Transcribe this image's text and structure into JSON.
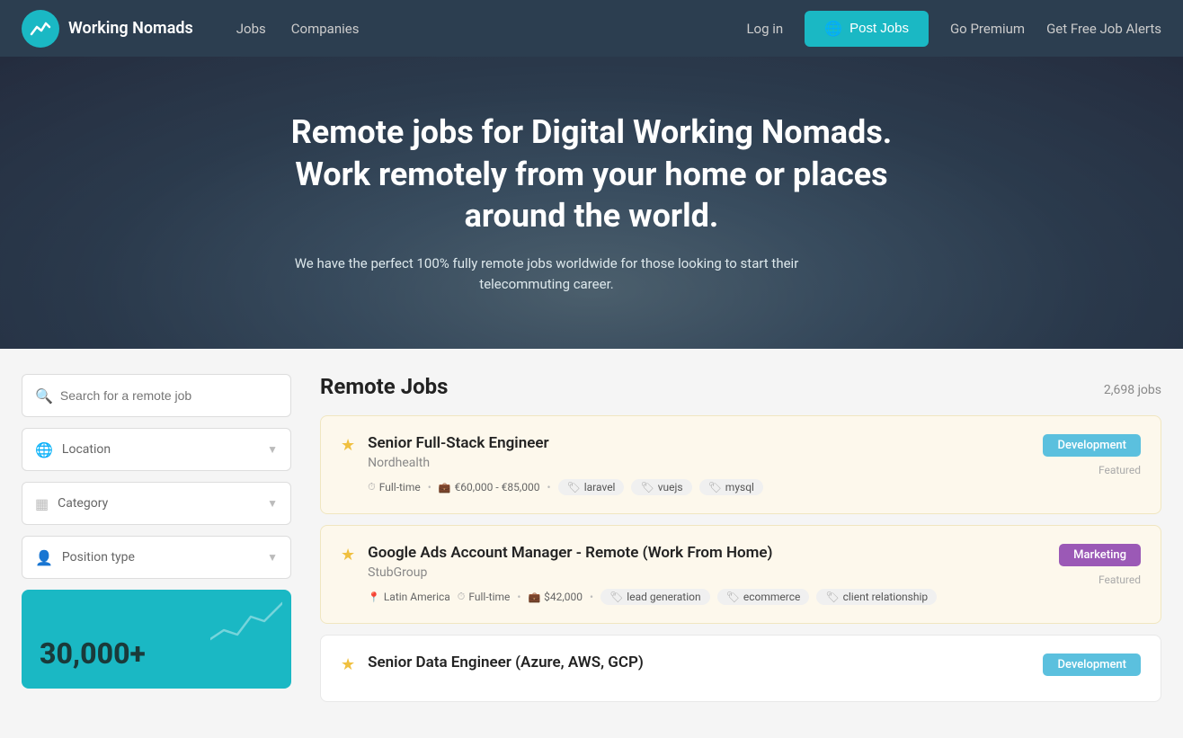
{
  "nav": {
    "brand": "Working Nomads",
    "logo_icon": "~",
    "links": [
      "Jobs",
      "Companies"
    ],
    "right_links": [
      "Log in",
      "Go Premium",
      "Get Free Job Alerts"
    ],
    "post_jobs_label": "Post Jobs"
  },
  "hero": {
    "title": "Remote jobs for Digital Working Nomads. Work remotely from your home or places around the world.",
    "subtitle": "We have the perfect 100% fully remote jobs worldwide for those looking to start their telecommuting career."
  },
  "sidebar": {
    "search_placeholder": "Search for a remote job",
    "filters": [
      {
        "id": "location",
        "label": "Location",
        "icon": "🌐"
      },
      {
        "id": "category",
        "label": "Category",
        "icon": "▦"
      },
      {
        "id": "position_type",
        "label": "Position type",
        "icon": "👤"
      }
    ],
    "promo_number": "30,000+"
  },
  "jobs": {
    "section_title": "Remote Jobs",
    "count_label": "2,698 jobs",
    "items": [
      {
        "id": 1,
        "featured": true,
        "starred": true,
        "title": "Senior Full-Stack Engineer",
        "company": "Nordhealth",
        "badge": "Development",
        "badge_type": "dev",
        "featured_label": "Featured",
        "tags": [
          {
            "type": "time",
            "icon": "⏱",
            "label": "Full-time"
          },
          {
            "type": "salary",
            "icon": "💼",
            "label": "€60,000 - €85,000"
          }
        ],
        "pills": [
          "laravel",
          "vuejs",
          "mysql"
        ]
      },
      {
        "id": 2,
        "featured": true,
        "starred": true,
        "title": "Google Ads Account Manager - Remote (Work From Home)",
        "company": "StubGroup",
        "badge": "Marketing",
        "badge_type": "marketing",
        "featured_label": "Featured",
        "tags": [
          {
            "type": "location",
            "icon": "📍",
            "label": "Latin America"
          },
          {
            "type": "time",
            "icon": "⏱",
            "label": "Full-time"
          },
          {
            "type": "salary",
            "icon": "💼",
            "label": "$42,000"
          }
        ],
        "pills": [
          "lead generation",
          "ecommerce",
          "client relationship"
        ]
      },
      {
        "id": 3,
        "featured": false,
        "starred": true,
        "title": "Senior Data Engineer (Azure, AWS, GCP)",
        "company": "",
        "badge": "Development",
        "badge_type": "dev",
        "featured_label": "",
        "tags": [],
        "pills": []
      }
    ]
  }
}
